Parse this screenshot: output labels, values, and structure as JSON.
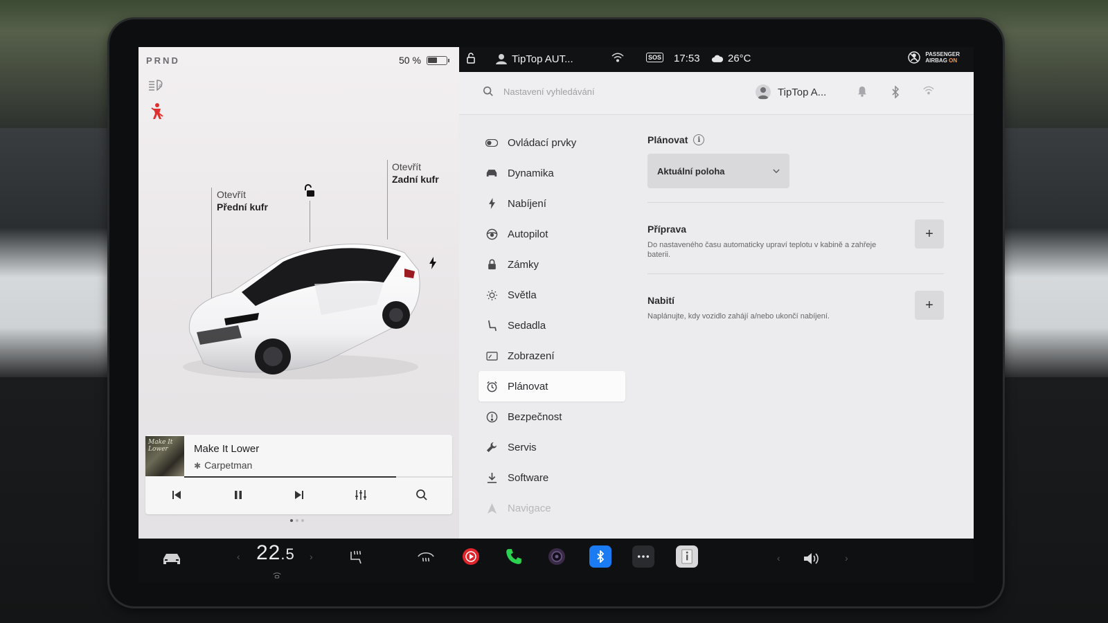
{
  "car": {
    "gear": "PRND",
    "battery_percent": "50 %",
    "battery_level": 0.5,
    "front_trunk": {
      "line1": "Otevřít",
      "line2": "Přední kufr"
    },
    "rear_trunk": {
      "line1": "Otevřít",
      "line2": "Zadní kufr"
    }
  },
  "media": {
    "album_art_text": "Make It Lower",
    "title": "Make It Lower",
    "artist": "Carpetman",
    "progress": 0.79
  },
  "status": {
    "profile": "TipTop AUT...",
    "sos": "SOS",
    "time": "17:53",
    "temperature": "26°C",
    "airbag_line1": "PASSENGER",
    "airbag_line2": "AIRBAG",
    "airbag_state": "ON"
  },
  "settings": {
    "search_placeholder": "Nastavení vyhledávání",
    "profile_name": "TipTop A...",
    "menu": [
      {
        "label": "Ovládací prvky",
        "icon": "toggle-icon"
      },
      {
        "label": "Dynamika",
        "icon": "car-icon"
      },
      {
        "label": "Nabíjení",
        "icon": "bolt-icon"
      },
      {
        "label": "Autopilot",
        "icon": "steering-wheel-icon"
      },
      {
        "label": "Zámky",
        "icon": "lock-icon"
      },
      {
        "label": "Světla",
        "icon": "sun-icon"
      },
      {
        "label": "Sedadla",
        "icon": "seat-icon"
      },
      {
        "label": "Zobrazení",
        "icon": "display-icon"
      },
      {
        "label": "Plánovat",
        "icon": "alarm-clock-icon"
      },
      {
        "label": "Bezpečnost",
        "icon": "alert-circle-icon"
      },
      {
        "label": "Servis",
        "icon": "wrench-icon"
      },
      {
        "label": "Software",
        "icon": "download-icon"
      },
      {
        "label": "Navigace",
        "icon": "navigation-icon"
      }
    ],
    "active_index": 8,
    "schedule": {
      "title": "Plánovat",
      "location_selected": "Aktuální poloha",
      "preconditioning": {
        "title": "Příprava",
        "description": "Do nastaveného času automaticky upraví teplotu v kabině a zahřeje baterii."
      },
      "charging": {
        "title": "Nabití",
        "description": "Naplánujte, kdy vozidlo zahájí a/nebo ukončí nabíjení."
      }
    }
  },
  "taskbar": {
    "cabin_temp": "22",
    "cabin_temp_decimal": ".5"
  },
  "colors": {
    "seatbelt_warning": "#e02f2f",
    "bluetooth_app": "#1a7bf2",
    "phone_app": "#2bd24f",
    "media_app": "#e0242c",
    "airbag_on": "#ff9b3d"
  }
}
